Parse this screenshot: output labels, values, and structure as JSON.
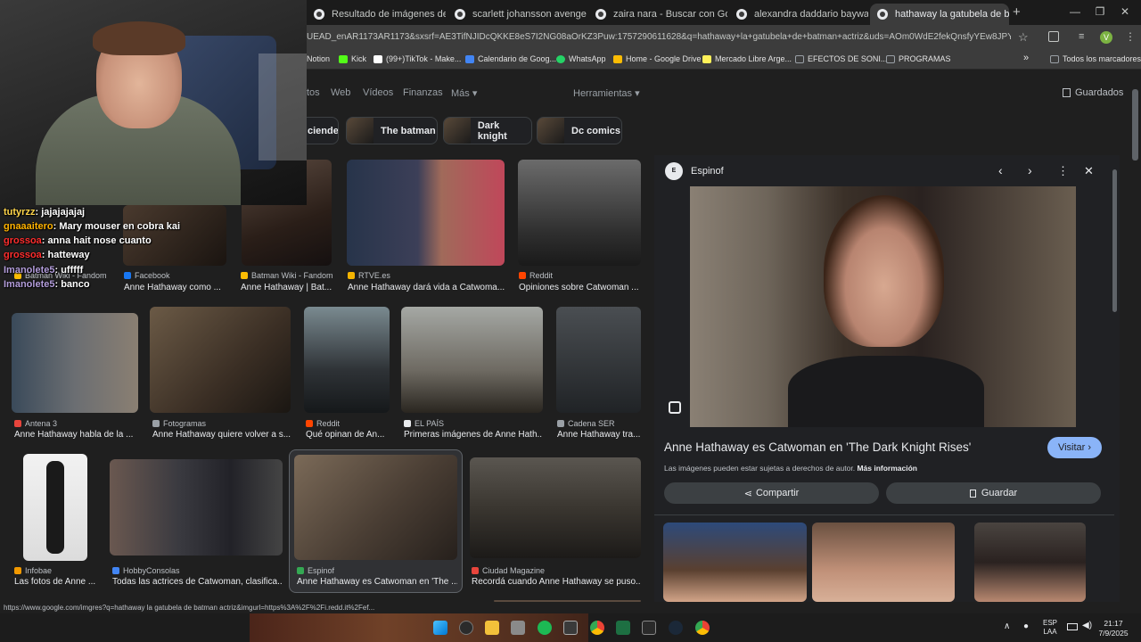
{
  "browser": {
    "tabs": [
      {
        "label": "Resultado de imágenes de Goo",
        "active": false
      },
      {
        "label": "scarlett johansson avengers 1",
        "active": false
      },
      {
        "label": "zaira nara - Buscar con Google",
        "active": false
      },
      {
        "label": "alexandra daddario baywatch",
        "active": false
      },
      {
        "label": "hathaway la gatubela de batm",
        "active": true
      }
    ],
    "new_tab": "+",
    "url": "UEAD_enAR1173AR1173&sxsrf=AE3TifNJIDcQKKE8eS7I2NG08aOrKZ3Puw:1757290611628&q=hathaway+la+gatubela+de+batman+actriz&uds=AOm0WdE2fekQnsfyYEw8JPYozOKzAEAfvZx...",
    "profile_initial": "V",
    "bookmarks": [
      {
        "label": "Notion",
        "color": "#ffffff"
      },
      {
        "label": "Kick",
        "color": "#53fc18"
      },
      {
        "label": "(99+)TikTok - Make...",
        "color": "#ffffff"
      },
      {
        "label": "Calendario de Goog...",
        "color": "#4285f4"
      },
      {
        "label": "WhatsApp",
        "color": "#25d366"
      },
      {
        "label": "Home - Google Drive",
        "color": "#fbbc04"
      },
      {
        "label": "Mercado Libre Arge...",
        "color": "#fff159"
      },
      {
        "label": "EFECTOS DE SONI...",
        "color": "#9aa0a6"
      },
      {
        "label": "PROGRAMAS",
        "color": "#9aa0a6"
      }
    ],
    "bookmarks_more": "»",
    "all_bookmarks": "Todos los marcadores"
  },
  "search_nav": {
    "items": [
      "tos",
      "Web",
      "Vídeos",
      "Finanzas",
      "Más ▾"
    ],
    "tools": "Herramientas ▾",
    "saved": "Guardados"
  },
  "chips": [
    "ciende",
    "The batman",
    "Dark knight",
    "Dc comics"
  ],
  "results": [
    {
      "source": "Batman Wiki - Fandom",
      "title": "",
      "sicolor": "#fbbc04"
    },
    {
      "source": "Facebook",
      "title": "Anne Hathaway como ...",
      "sicolor": "#1877f2"
    },
    {
      "source": "Batman Wiki - Fandom",
      "title": "Anne Hathaway | Bat...",
      "sicolor": "#fbbc04"
    },
    {
      "source": "RTVE.es",
      "title": "Anne Hathaway dará vida a Catwoma...",
      "sicolor": "#f4b400"
    },
    {
      "source": "Reddit",
      "title": "Opiniones sobre Catwoman ...",
      "sicolor": "#ff4500"
    },
    {
      "source": "Antena 3",
      "title": "Anne Hathaway habla de la ...",
      "sicolor": "#e8453c"
    },
    {
      "source": "Fotogramas",
      "title": "Anne Hathaway quiere volver a s...",
      "sicolor": "#9aa0a6"
    },
    {
      "source": "Reddit",
      "title": "Qué opinan de An...",
      "sicolor": "#ff4500"
    },
    {
      "source": "EL PAÍS",
      "title": "Primeras imágenes de Anne Hath...",
      "sicolor": "#e8eaed"
    },
    {
      "source": "Cadena SER",
      "title": "Anne Hathaway tra...",
      "sicolor": "#9aa0a6"
    },
    {
      "source": "Infobae",
      "title": "Las fotos de Anne ...",
      "sicolor": "#f29900"
    },
    {
      "source": "HobbyConsolas",
      "title": "Todas las actrices de Catwoman, clasifica...",
      "sicolor": "#4285f4"
    },
    {
      "source": "Espinof",
      "title": "Anne Hathaway es Catwoman en 'The ...",
      "sicolor": "#34a853"
    },
    {
      "source": "Ciudad Magazine",
      "title": "Recordá cuando Anne Hathaway se puso...",
      "sicolor": "#e8453c"
    }
  ],
  "detail": {
    "source": "Espinof",
    "title": "Anne Hathaway es Catwoman en 'The Dark Knight Rises'",
    "visit": "Visitar ›",
    "copyright": "Las imágenes pueden estar sujetas a derechos de autor.",
    "more_info": "Más información",
    "share": "Compartir",
    "save": "Guardar"
  },
  "stream": {
    "chat": [
      {
        "user": "tutyrzz",
        "msg": "jajajajajaj",
        "color": "#ffd54a"
      },
      {
        "user": "gnaaaitero",
        "msg": "Mary mouser en cobra kai",
        "color": "#ffb300"
      },
      {
        "user": "grossoa",
        "msg": "anna hait nose cuanto",
        "color": "#ff2d2d"
      },
      {
        "user": "grossoa",
        "msg": "hatteway",
        "color": "#ff2d2d"
      },
      {
        "user": "Imanolete5",
        "msg": "ufffff",
        "color": "#b39ddb"
      },
      {
        "user": "Imanolete5",
        "msg": "banco",
        "color": "#b39ddb"
      }
    ]
  },
  "status_url": "https://www.google.com/imgres?q=hathaway la gatubela de batman actriz&imgurl=https%3A%2F%2Fi.redd.it%2Fef...",
  "system": {
    "lang": "ESP",
    "region": "LAA",
    "time": "21:17",
    "date": "7/9/2025"
  }
}
